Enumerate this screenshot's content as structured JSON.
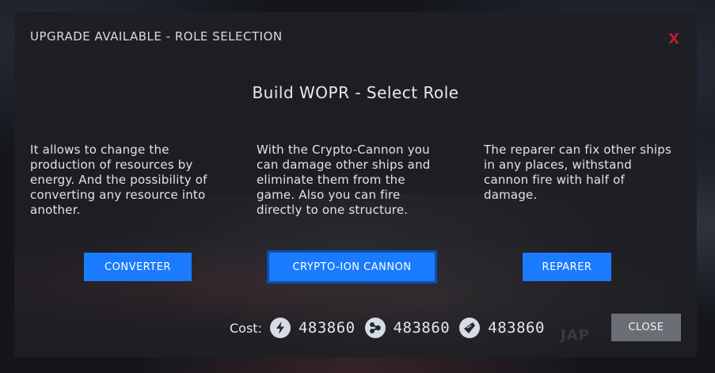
{
  "header": {
    "title": "UPGRADE AVAILABLE - ROLE SELECTION",
    "close_label": "X"
  },
  "main": {
    "title": "Build WOPR - Select Role"
  },
  "roles": [
    {
      "description": "It allows to change the production of resources by energy. And the possibility of converting any resource into another.",
      "button_label": "CONVERTER"
    },
    {
      "description": "With the Crypto-Cannon you can damage other ships and eliminate them from the game. Also you can fire directly to one structure.",
      "button_label": "CRYPTO-ION CANNON"
    },
    {
      "description": "The reparer can fix other ships in any places, withstand cannon fire with half of damage.",
      "button_label": "REPARER"
    }
  ],
  "cost": {
    "label": "Cost:",
    "resources": [
      {
        "icon": "energy-icon",
        "value": "483860"
      },
      {
        "icon": "molecule-icon",
        "value": "483860"
      },
      {
        "icon": "crystal-icon",
        "value": "483860"
      }
    ]
  },
  "footer": {
    "close_button_label": "CLOSE"
  },
  "colors": {
    "accent": "#1a7bff",
    "close_x": "#b5202a",
    "modal_bg": "#1e1f24",
    "close_button": "#6b6e74"
  }
}
